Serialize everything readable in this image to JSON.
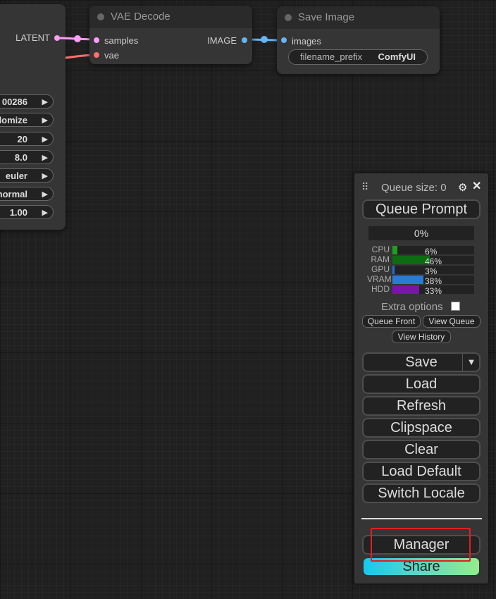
{
  "left_node": {
    "output_label": "LATENT",
    "widgets": [
      "00286",
      "domize",
      "20",
      "8.0",
      "euler",
      "normal",
      "1.00"
    ]
  },
  "vae_decode": {
    "title": "VAE Decode",
    "input_samples": "samples",
    "input_vae": "vae",
    "output_image": "IMAGE"
  },
  "save_image": {
    "title": "Save Image",
    "input_images": "images",
    "widget_label": "filename_prefix",
    "widget_value": "ComfyUI"
  },
  "panel": {
    "queue_size": "Queue size: 0",
    "queue_prompt": "Queue Prompt",
    "progress": "0%",
    "stats": [
      {
        "label": "CPU",
        "value": 6,
        "text": "6%",
        "color": "#1aa31a"
      },
      {
        "label": "RAM",
        "value": 46,
        "text": "46%",
        "color": "#0d6b12"
      },
      {
        "label": "GPU",
        "value": 3,
        "text": "3%",
        "color": "#1e6fd9"
      },
      {
        "label": "VRAM",
        "value": 38,
        "text": "38%",
        "color": "#2a7ad6"
      },
      {
        "label": "HDD",
        "value": 33,
        "text": "33%",
        "color": "#7b14a8"
      }
    ],
    "extra_options": "Extra options",
    "queue_front": "Queue Front",
    "view_queue": "View Queue",
    "view_history": "View History",
    "save": "Save",
    "load": "Load",
    "refresh": "Refresh",
    "clipspace": "Clipspace",
    "clear": "Clear",
    "load_default": "Load Default",
    "switch_locale": "Switch Locale",
    "manager": "Manager",
    "share": "Share"
  },
  "colors": {
    "latent_wire": "#ff9cf9",
    "vae_wire": "#ff6e6e",
    "image_wire": "#64b5f6",
    "highlight_box": "#e02020"
  }
}
